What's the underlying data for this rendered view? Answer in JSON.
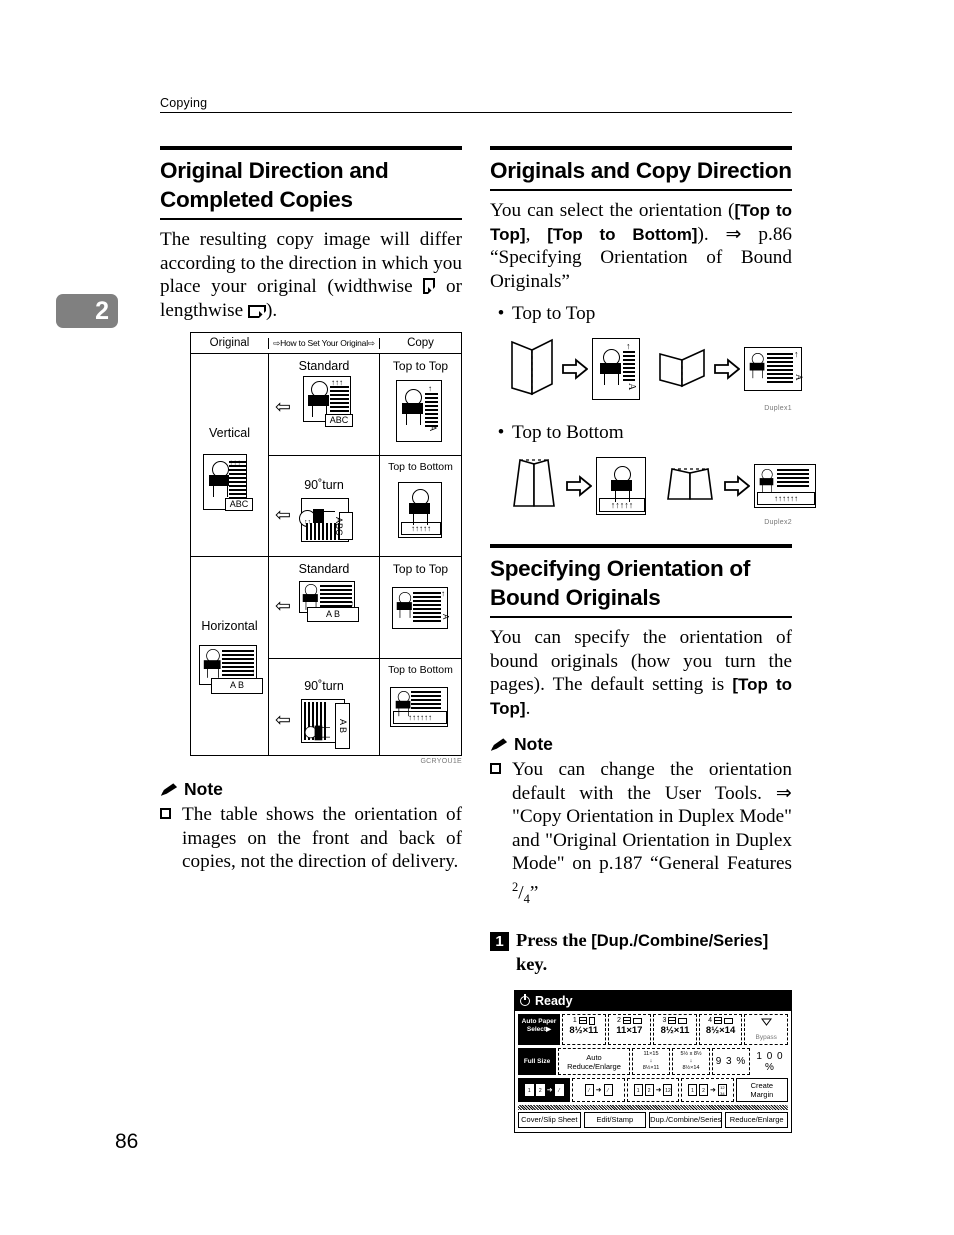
{
  "running_head": "Copying",
  "chapter_tab": "2",
  "page_number": "86",
  "left": {
    "heading": [
      "Original Direction and",
      "Completed Copies"
    ],
    "intro": "The resulting copy image will differ according to the direction in which you place your original (widthwise",
    "intro_mid": " or lengthwise ",
    "intro_end": ").",
    "table": {
      "headers": {
        "original": "Original",
        "how_to_set": "How to Set Your Original",
        "copy": "Copy",
        "arrow": "⇨"
      },
      "rows": [
        {
          "orientation": "Vertical",
          "original_tag": "ABC",
          "variants": [
            {
              "set_label": "Standard",
              "copy_label": "Top to Top",
              "tag": "ABC",
              "arrow": "⇦"
            },
            {
              "set_label": "90˚turn",
              "copy_label": "Top to Bottom",
              "tag": "ABC",
              "arrow": "⇦"
            }
          ]
        },
        {
          "orientation": "Horizontal",
          "original_tag": "A    B",
          "variants": [
            {
              "set_label": "Standard",
              "copy_label": "Top to Top",
              "tag": "A    B",
              "arrow": "⇦"
            },
            {
              "set_label": "90˚turn",
              "copy_label": "Top to Bottom",
              "tag": "A    B",
              "arrow": "⇦"
            }
          ]
        }
      ],
      "caption": "GCRYOU1E"
    },
    "note": {
      "title": "Note",
      "items": [
        "The table shows the orientation of images on the front and back of copies, not the direction of delivery."
      ]
    }
  },
  "right": {
    "heading1": [
      "Originals and Copy Direction"
    ],
    "para1_a": "You can select the orientation (",
    "para1_key1": "[Top to Top]",
    "para1_b": ", ",
    "para1_key2": "[Top to Bottom]",
    "para1_c": "). ⇒ p.86 “Specifying Orientation of Bound Originals”",
    "bullets": [
      {
        "label": "Top to Top",
        "caption": "Duplex1"
      },
      {
        "label": "Top to Bottom",
        "caption": "Duplex2"
      }
    ],
    "heading2": [
      "Specifying Orientation of",
      "Bound Originals"
    ],
    "para2_a": "You can specify the orientation of bound originals (how you turn the pages). The default setting is ",
    "para2_key": "[Top to Top]",
    "para2_b": ".",
    "note": {
      "title": "Note",
      "items_rich": {
        "a": "You can change the orientation default with the User Tools. ⇒ \"Copy Orientation in Duplex Mode\" and \"Original Orientation in Duplex Mode\" on p.187 “General Features ",
        "sup": "2",
        "slash": "/",
        "sub": "4",
        "b": "”"
      }
    },
    "step": {
      "number": "1",
      "text_a": "Press the ",
      "key": "[Dup./Combine/Series]",
      "text_b": " key."
    },
    "lcd": {
      "status": "Ready",
      "auto_paper_select": "Auto Paper Select▶",
      "trays": [
        {
          "num": "1",
          "size": "8½×11",
          "sheet": "portrait"
        },
        {
          "num": "2",
          "size": "11×17",
          "sheet": "landscape"
        },
        {
          "num": "3",
          "size": "8½×11",
          "sheet": "landscape"
        },
        {
          "num": "4",
          "size": "8½×14",
          "sheet": "landscape"
        }
      ],
      "bypass": "Bypass",
      "full_size": "Full Size",
      "auto_reduce": "Auto Reduce/Enlarge",
      "ratio1_from": "11×15",
      "ratio1_to": "8½×11",
      "ratio2_from": "5½ x 8½",
      "ratio2_to": "8½×14",
      "ratio_93": "9 3 %",
      "ratio_100": "1 0 0 %",
      "create_margin": [
        "Create",
        "Margin"
      ],
      "tabs": [
        "Cover/Slip Sheet",
        "Edit/Stamp",
        "Dup./Combine/Series",
        "Reduce/Enlarge"
      ]
    }
  }
}
